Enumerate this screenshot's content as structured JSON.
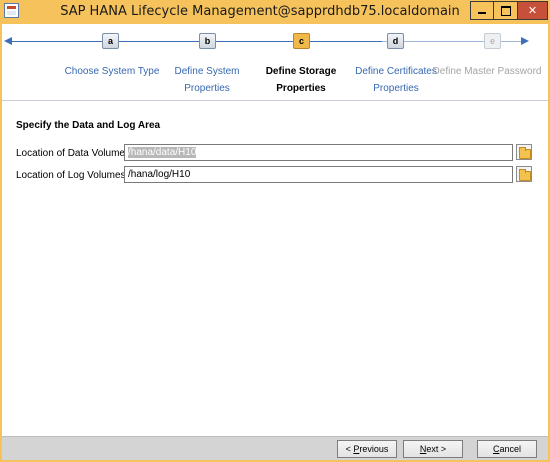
{
  "window": {
    "title": "SAP HANA Lifecycle Management@sapprdhdb75.localdomain"
  },
  "roadmap": {
    "steps": [
      {
        "letter": "a",
        "label_line1": "Choose System Type",
        "label_line2": "",
        "state": "done"
      },
      {
        "letter": "b",
        "label_line1": "Define System",
        "label_line2": "Properties",
        "state": "done"
      },
      {
        "letter": "c",
        "label_line1": "Define Storage",
        "label_line2": "Properties",
        "state": "current"
      },
      {
        "letter": "d",
        "label_line1": "Define Certificates",
        "label_line2": "Properties",
        "state": "todo"
      },
      {
        "letter": "e",
        "label_line1": "Define Master Password",
        "label_line2": "",
        "state": "disabled"
      }
    ]
  },
  "form": {
    "section_title": "Specify the Data and Log Area",
    "data_volumes": {
      "label": "Location of Data Volumes:",
      "value": "/hana/data/H10"
    },
    "log_volumes": {
      "label": "Location of Log Volumes:",
      "value": "/hana/log/H10"
    }
  },
  "buttons": {
    "previous": {
      "prefix": "< ",
      "mnemonic": "P",
      "rest": "revious"
    },
    "next": {
      "mnemonic": "N",
      "rest": "ext >"
    },
    "cancel": {
      "mnemonic": "C",
      "rest": "ancel"
    }
  },
  "colors": {
    "title_bar": "#f6c25c",
    "roadmap_line": "#3c6fb5",
    "current_step": "#f0b94a",
    "link_text": "#3768b1"
  }
}
